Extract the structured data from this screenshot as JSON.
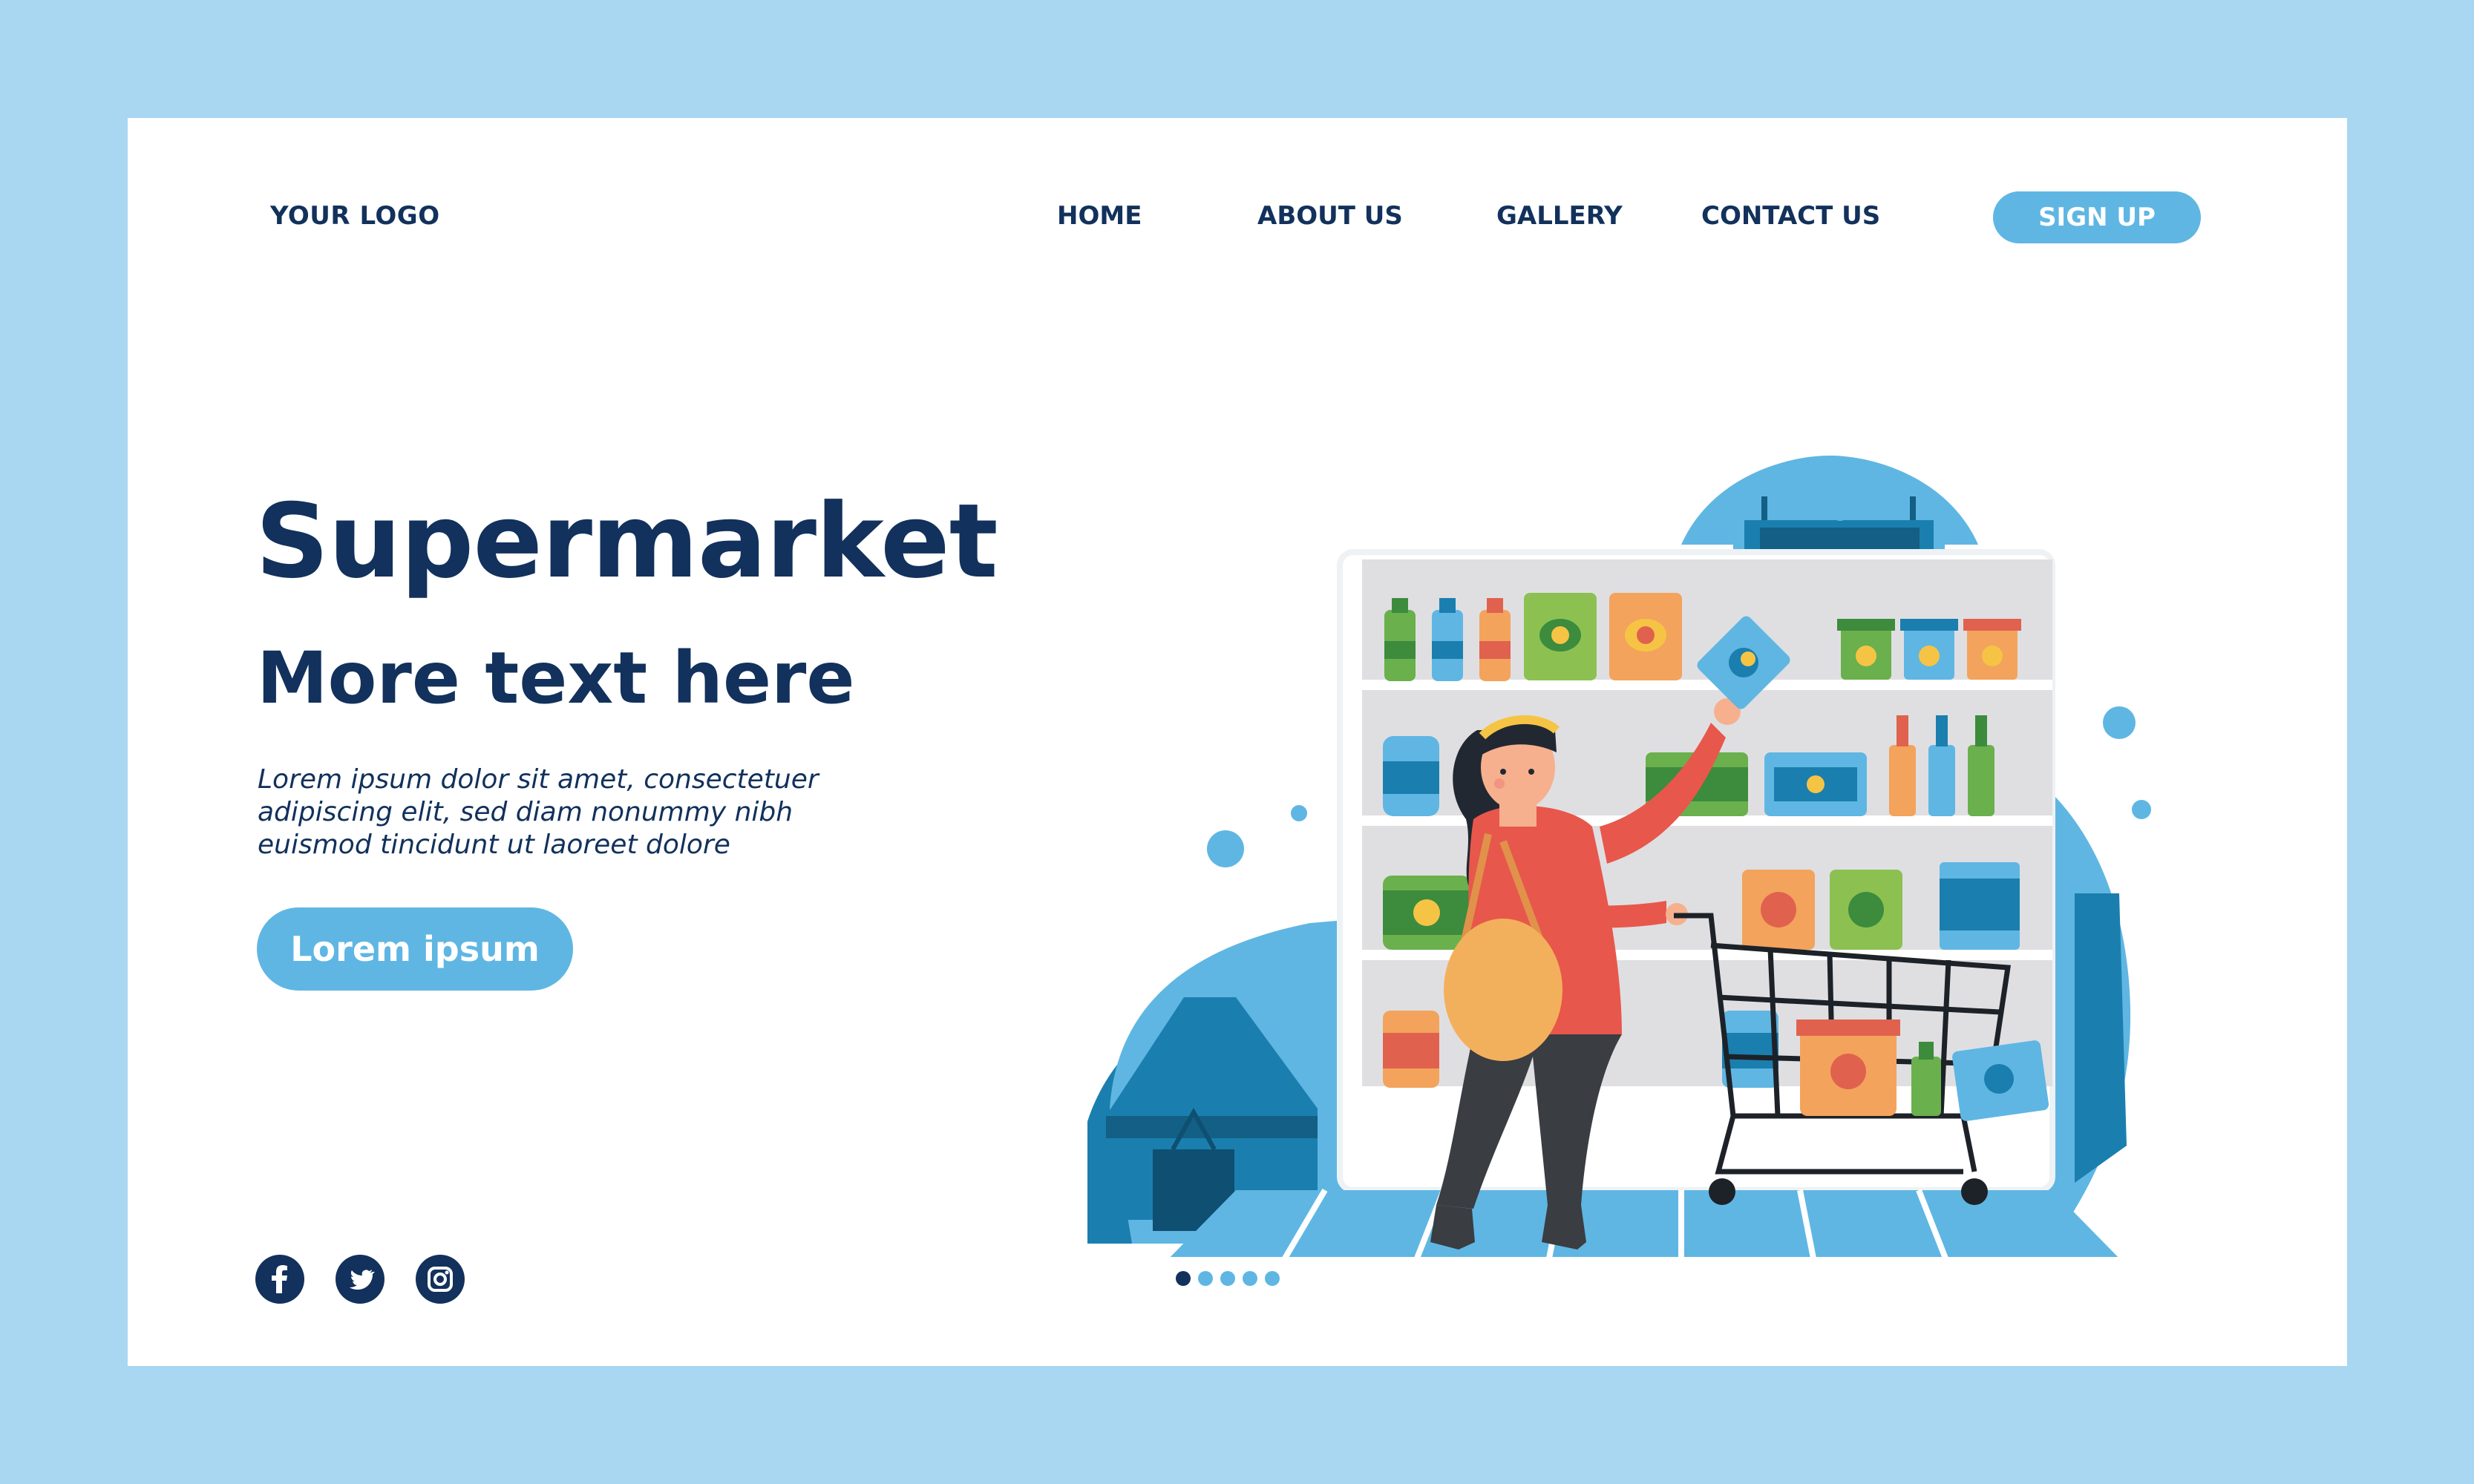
{
  "header": {
    "logo": "YOUR LOGO",
    "nav": [
      {
        "label": "HOME"
      },
      {
        "label": "ABOUT US"
      },
      {
        "label": "GALLERY"
      },
      {
        "label": "CONTACT US"
      }
    ],
    "signup_label": "SIGN UP"
  },
  "hero": {
    "title": "Supermarket",
    "subtitle": "More text here",
    "body": "Lorem ipsum dolor sit amet, consectetuer adipiscing elit, sed diam nonummy nibh euismod tincidunt ut laoreet dolore",
    "cta_label": "Lorem ipsum"
  },
  "social": [
    {
      "icon": "facebook-icon"
    },
    {
      "icon": "twitter-icon"
    },
    {
      "icon": "instagram-icon"
    }
  ],
  "pagination": {
    "count": 5,
    "active": 1
  },
  "colors": {
    "background": "#a9d6f0",
    "navy": "#12315c",
    "accent": "#5fb6e3",
    "blue_dark": "#1a7fae",
    "shelf": "#dfdfe2"
  }
}
